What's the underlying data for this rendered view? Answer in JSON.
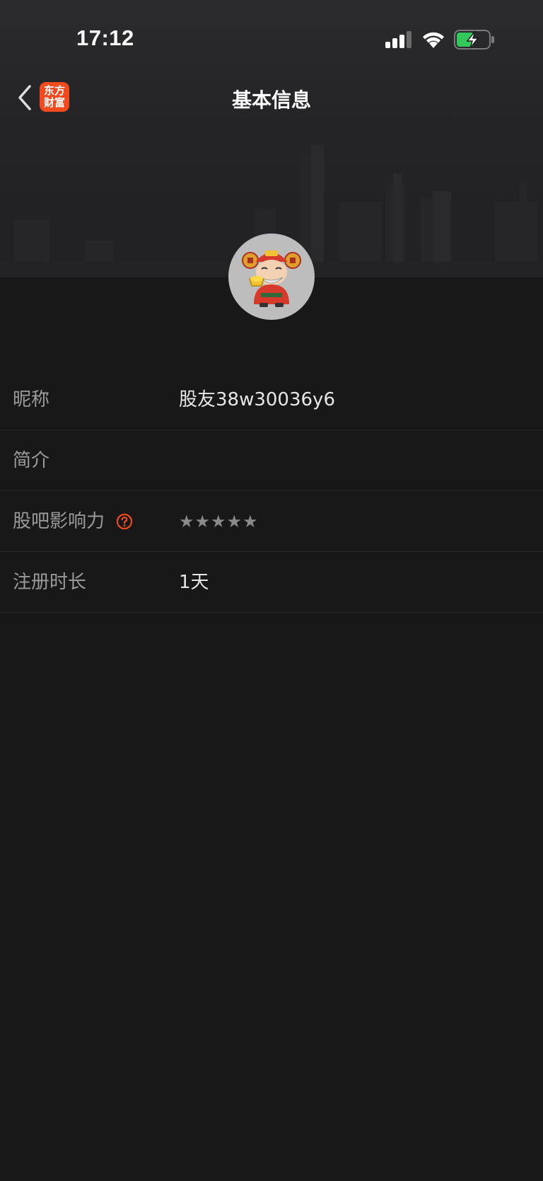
{
  "status_bar": {
    "time": "17:12",
    "icons": [
      "signal-icon",
      "wifi-icon",
      "battery-charging-icon"
    ]
  },
  "nav": {
    "back_icon": "chevron-left-icon",
    "app_logo_line1": "东方",
    "app_logo_line2": "财富",
    "title": "基本信息"
  },
  "profile": {
    "avatar_icon": "god-of-wealth-avatar"
  },
  "rows": [
    {
      "label": "昵称",
      "value": "股友38w30036y6"
    },
    {
      "label": "简介",
      "value": ""
    },
    {
      "label": "股吧影响力",
      "value": "★★★★★",
      "rating": 0,
      "rating_max": 5,
      "help_icon": "question-circle-icon"
    },
    {
      "label": "注册时长",
      "value": "1天"
    }
  ],
  "colors": {
    "background": "#181818",
    "accent": "#f04a1e",
    "battery_green": "#34c759",
    "label": "#9a9a9a",
    "value": "#e6e6e6"
  }
}
